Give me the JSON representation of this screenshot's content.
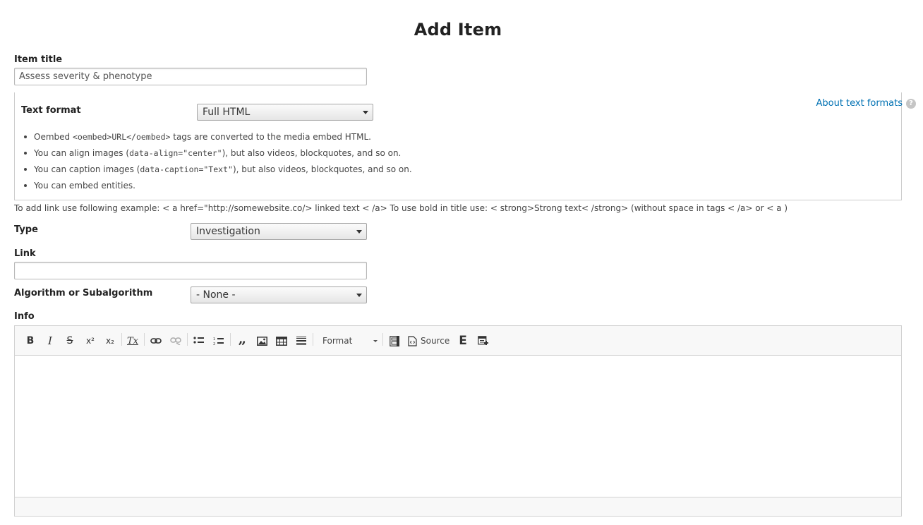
{
  "page": {
    "title": "Add Item"
  },
  "item_title": {
    "label": "Item title",
    "value": "Assess severity & phenotype"
  },
  "text_format": {
    "label": "Text format",
    "selected": "Full HTML",
    "about_link": "About text formats",
    "help_icon": "?",
    "tips": [
      {
        "a": "Oembed ",
        "code": "<oembed>URL</oembed>",
        "b": " tags are converted to the media embed HTML."
      },
      {
        "a": "You can align images (",
        "code": "data-align=\"center\"",
        "b": "), but also videos, blockquotes, and so on."
      },
      {
        "a": "You can caption images (",
        "code": "data-caption=\"Text\"",
        "b": "), but also videos, blockquotes, and so on."
      },
      {
        "a": "You can embed entities.",
        "code": "",
        "b": ""
      }
    ]
  },
  "help_text": "To add link use following example: < a href=\"http://somewebsite.co/> linked text < /a> To use bold in title use: < strong>Strong text< /strong> (without space in tags < /a> or < a )",
  "type": {
    "label": "Type",
    "selected": "Investigation"
  },
  "link": {
    "label": "Link",
    "value": ""
  },
  "algorithm": {
    "label": "Algorithm or Subalgorithm",
    "selected": "- None -"
  },
  "info": {
    "label": "Info",
    "toolbar": {
      "bold": "B",
      "italic": "I",
      "strike": "S",
      "superscript": "x²",
      "subscript": "x₂",
      "remove_format": "Tx",
      "format_label": "Format",
      "source_label": "Source",
      "entity_glyph": "E",
      "icons": [
        "bold-icon",
        "italic-icon",
        "strikethrough-icon",
        "superscript-icon",
        "subscript-icon",
        "remove-format-icon",
        "link-icon",
        "unlink-icon",
        "bulleted-list-icon",
        "numbered-list-icon",
        "blockquote-icon",
        "image-icon",
        "table-icon",
        "horizontal-line-icon",
        "format-dropdown",
        "show-blocks-icon",
        "source-icon",
        "entity-embed-icon",
        "template-icon"
      ]
    }
  },
  "colors": {
    "link": "#0071b3",
    "toolbar_bg": "#f8f8f8",
    "border": "#d1d1d1"
  }
}
